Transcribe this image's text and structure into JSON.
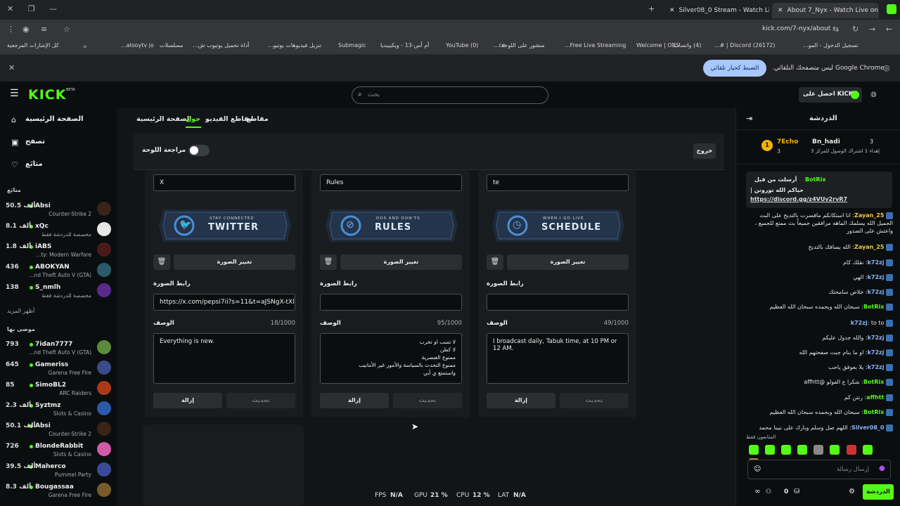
{
  "browser": {
    "tabs": [
      {
        "title": "About 7_Nyx - Watch Live on Kick"
      },
      {
        "title": "Silver08_0 Stream - Watch Live on Kick"
      }
    ],
    "url": "kick.com/7-nyx/about",
    "bookmarks": [
      "تسجيل الدخول - المو...",
      "(26172) Discord | #...",
      "(4) واتساب",
      "Welcome | OBS",
      "Free Live Streaming...",
      "منشور على اللوحة",
      "ce...",
      "(0) YouTube",
      "أم أس-13 - ويكيبيديا",
      "Submagic",
      "تنزيل فيديوهات يوتيو...",
      "أداة تحميل يوتيوب ش...",
      "مسلسلات",
      "alooytv jo...",
      "كل الإشارات المرجعية"
    ],
    "infobar": {
      "text": "Google Chrome ليس متصفحك التلقائي.",
      "button": "الضبط كخيار تلقائي"
    }
  },
  "kick": {
    "logo": "KICK",
    "beta": "BETA",
    "search_placeholder": "بحث",
    "get_kicks": "احصل على KICKs"
  },
  "nav": {
    "home": "الصفحة الرئيسية",
    "browse": "تصفح",
    "following": "متابَع",
    "following_header": "متابَع",
    "show_more": "أظهر المزيد",
    "recommended_header": "موصى بها"
  },
  "following": [
    {
      "name": "Absi",
      "viewers": "50.5 ألف",
      "game": "Counter-Strike 2"
    },
    {
      "name": "xQc",
      "viewers": "8.1 ألف",
      "game": "مخصصة للدردشة فقط"
    },
    {
      "name": "iABS",
      "viewers": "1.8 ألف",
      "game": "...ty: Modern Warfare"
    },
    {
      "name": "ABOKYAN",
      "viewers": "436",
      "game": "...nd Theft Auto V (GTA)"
    },
    {
      "name": "S_nmlh",
      "viewers": "138",
      "game": "مخصصة للدردشة فقط"
    }
  ],
  "recommended": [
    {
      "name": "7idan7777",
      "viewers": "793",
      "game": "...nd Theft Auto V (GTA)"
    },
    {
      "name": "Gameriss",
      "viewers": "645",
      "game": "Garena Free Fire"
    },
    {
      "name": "SimoBL2",
      "viewers": "85",
      "game": "ARC Raiders"
    },
    {
      "name": "Syztmz",
      "viewers": "2.3 ألف",
      "game": "Slots & Casino"
    },
    {
      "name": "Absi",
      "viewers": "50.1 ألف",
      "game": "Counter-Strike 2"
    },
    {
      "name": "BlondeRabbit",
      "viewers": "726",
      "game": "Slots & Casino"
    },
    {
      "name": "Maherco",
      "viewers": "39.5 ألف",
      "game": "Pummel Party"
    },
    {
      "name": "Bougassaa",
      "viewers": "8.3 ألف",
      "game": "Garena Free Fire"
    }
  ],
  "channel_tabs": [
    "الصفحة الرئيسية",
    "حول",
    "مقاطع الفيديو",
    "مقاطع"
  ],
  "panel_review": {
    "label": "مراجعة اللوحة",
    "exit": "خروج"
  },
  "panels": [
    {
      "title": "te",
      "banner": "SCHEDULE",
      "banner_sub": "WHEN I GO LIVE",
      "change_image": "تغيير الصورة",
      "image_link_label": "رابط الصورة",
      "image_link": "",
      "desc_label": "الوصف",
      "counter": "49/1000",
      "description": "I broadcast daily, Tabuk time, at 10 PM or 12 AM.",
      "update": "تحديث",
      "remove": "إزالة"
    },
    {
      "title": "Rules",
      "banner": "RULES",
      "banner_sub": "DOS AND DON'TS",
      "change_image": "تغيير الصورة",
      "image_link_label": "رابط الصورة",
      "image_link": "",
      "desc_label": "الوصف",
      "counter": "95/1000",
      "description_lines": [
        "لا تسب او تخرب",
        "لا كطن",
        "ممنوع العنصرية",
        "ممنوع التحدث بالسياسة والأمور غير الأمانيب",
        "",
        "واستمتع ي أبي"
      ],
      "update": "تحديث",
      "remove": "إزالة"
    },
    {
      "title": "X",
      "banner": "TWITTER",
      "banner_sub": "STAY CONNECTED",
      "change_image": "تغيير الصورة",
      "image_link_label": "رابط الصورة",
      "image_link": "https://x.com/pepsi7ii?s=11&t=aJSNgX-tXl",
      "desc_label": "الوصف",
      "counter": "18/1000",
      "description": "Everything is new.",
      "update": "تحديث",
      "remove": "إزالة"
    }
  ],
  "stats": {
    "fps_label": "FPS",
    "fps": "N/A",
    "gpu_label": "GPU",
    "gpu": "21 %",
    "cpu_label": "CPU",
    "cpu": "12 %",
    "lat_label": "LAT",
    "lat": "N/A"
  },
  "chat": {
    "title": "الدردشة",
    "leaderboard": [
      {
        "rank": "1",
        "name": "7Echo",
        "count": "3"
      },
      {
        "name": "Bn_hadi",
        "count": "3"
      }
    ],
    "leaderboard_sub": "إهداء 1 اشتراك الوصول للمركز 3",
    "pinned_user": "BotRix",
    "pinned_by": "أرسلت من قبل",
    "pinned_text": "حياكم الله تورونن |",
    "pinned_link": "https://discord.gg/z4VUv2rvR7",
    "messages": [
      {
        "user": "Zayan_25",
        "text": "انا استكانكم مافسرت بالتديح على البث الجميل الله يسلمك الماهه مرافقين جميعاً بث ممتع للجميع ، واعتش على الصدور"
      },
      {
        "user": "Zayan_25",
        "text": "الله يسافك بالتديح"
      },
      {
        "user": "k72zj",
        "text": "نقلك كام"
      },
      {
        "user": "k72zj",
        "text": "الهي"
      },
      {
        "user": "k72zj",
        "text": "خلاص سامحتك"
      },
      {
        "user": "BotRix",
        "text": "سبحان الله وبحمده سبحان الله العظيم"
      },
      {
        "user": "k72zj",
        "text": "to to"
      },
      {
        "user": "k72zj",
        "text": "والله جدول عليكم"
      },
      {
        "user": "k72zj",
        "text": "او ما بنام جبت صفحتهم الله"
      },
      {
        "user": "k72zj",
        "text": "يلا بعوفق ياحب"
      },
      {
        "user": "BotRix",
        "text": "شكرا ع الفولو @affhtt"
      },
      {
        "user": "affhtt",
        "text": "رنتن كم"
      },
      {
        "user": "BotRix",
        "text": "سبحان الله وبحمده سبحان الله العظيم"
      },
      {
        "user": "Silver08_0",
        "text": "اللهم صل وسلم وبارك على نبينا محمد"
      }
    ],
    "supporters_label": "المتابعون فقط",
    "input_placeholder": "إرسال رسالة",
    "points": "0",
    "send": "الدردشة"
  }
}
